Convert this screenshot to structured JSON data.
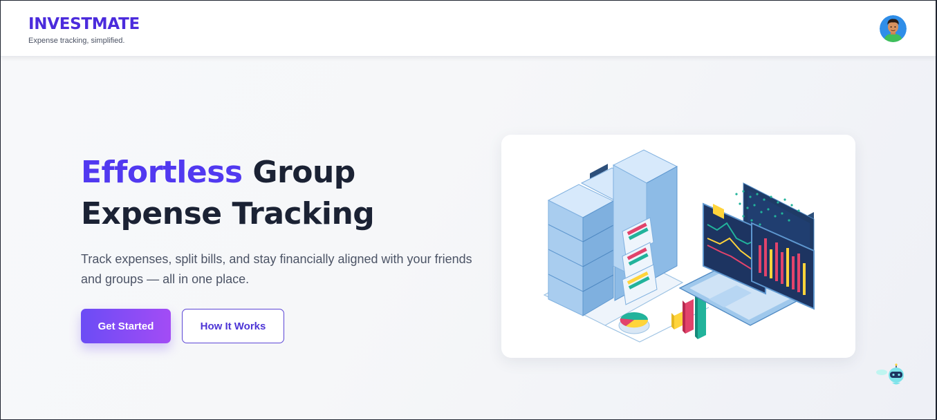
{
  "header": {
    "brand_name": "INVESTMATE",
    "tagline": "Expense tracking, simplified."
  },
  "hero": {
    "title_accent": "Effortless",
    "title_rest_line1": " Group",
    "title_line2": "Expense Tracking",
    "subtitle": "Track expenses, split bills, and stay financially aligned with your friends and groups — all in one place.",
    "primary_button": "Get Started",
    "secondary_button": "How It Works"
  },
  "illustration": {
    "subject": "isometric servers, laptop and charts"
  },
  "chatbot": {
    "icon": "robot-icon"
  },
  "colors": {
    "accent": "#5139f0",
    "brand": "#4b2bdc",
    "button_gradient_start": "#6b4cf5",
    "button_gradient_end": "#a34cf5",
    "heading": "#1b2234"
  }
}
